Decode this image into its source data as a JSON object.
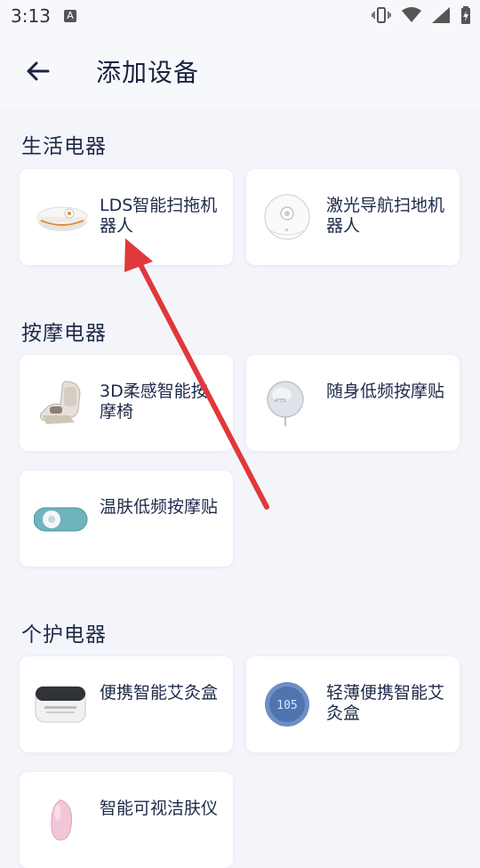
{
  "status_bar": {
    "time": "3:13",
    "notif_letter": "A"
  },
  "header": {
    "title": "添加设备"
  },
  "sections": [
    {
      "title": "生活电器",
      "items": [
        {
          "label": "LDS智能扫拖机器人",
          "icon": "robot-vacuum-lds-icon"
        },
        {
          "label": "激光导航扫地机器人",
          "icon": "robot-vacuum-laser-icon"
        }
      ]
    },
    {
      "title": "按摩电器",
      "items": [
        {
          "label": "3D柔感智能按摩椅",
          "icon": "massage-chair-icon"
        },
        {
          "label": "随身低频按摩贴",
          "icon": "portable-massager-icon"
        },
        {
          "label": "温肤低频按摩贴",
          "icon": "warm-massager-icon"
        }
      ]
    },
    {
      "title": "个护电器",
      "items": [
        {
          "label": "便携智能艾灸盒",
          "icon": "moxibustion-box-icon"
        },
        {
          "label": "轻薄便携智能艾灸盒",
          "icon": "thin-moxibustion-icon",
          "display": "105"
        },
        {
          "label": "智能可视洁肤仪",
          "icon": "skin-cleanser-icon"
        }
      ]
    }
  ],
  "annotation": {
    "type": "red-arrow",
    "color": "#e0383b"
  }
}
